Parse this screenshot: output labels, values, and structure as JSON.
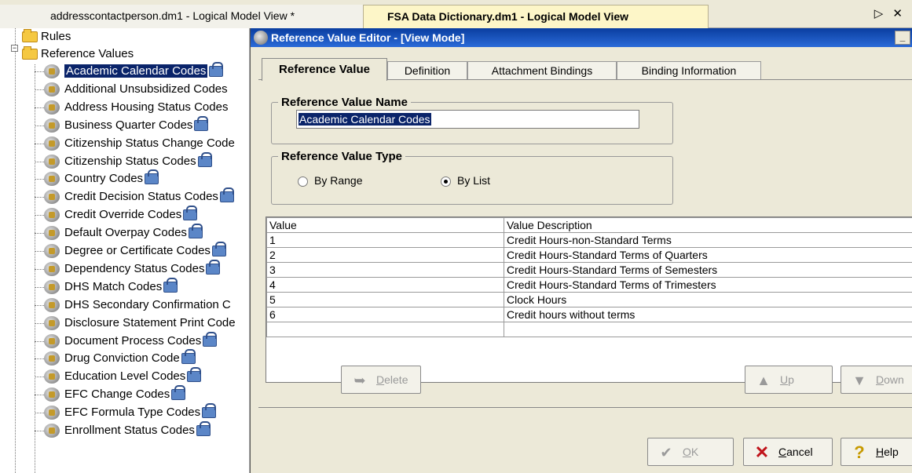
{
  "doc_tabs": [
    {
      "label": "addresscontactperson.dm1 - Logical Model View *"
    },
    {
      "label": "FSA Data Dictionary.dm1 - Logical Model View"
    }
  ],
  "tab_nav_glyph": "▷ ✕",
  "tree": {
    "rules": "Rules",
    "reference_values": "Reference Values",
    "items": [
      {
        "label": "Academic Calendar Codes",
        "locked": true,
        "selected": true
      },
      {
        "label": "Additional Unsubsidized Codes",
        "locked": false
      },
      {
        "label": "Address Housing Status Codes",
        "locked": false
      },
      {
        "label": "Business Quarter Codes",
        "locked": true
      },
      {
        "label": "Citizenship Status Change Code",
        "locked": false
      },
      {
        "label": "Citizenship Status Codes",
        "locked": true
      },
      {
        "label": "Country Codes",
        "locked": true
      },
      {
        "label": "Credit Decision Status Codes",
        "locked": true
      },
      {
        "label": "Credit Override Codes",
        "locked": true
      },
      {
        "label": "Default Overpay Codes",
        "locked": true
      },
      {
        "label": "Degree or Certificate Codes",
        "locked": true
      },
      {
        "label": "Dependency Status Codes",
        "locked": true
      },
      {
        "label": "DHS Match Codes",
        "locked": true
      },
      {
        "label": "DHS Secondary Confirmation C",
        "locked": false
      },
      {
        "label": "Disclosure Statement Print Code",
        "locked": false
      },
      {
        "label": "Document Process Codes",
        "locked": true
      },
      {
        "label": "Drug Conviction Code",
        "locked": true
      },
      {
        "label": "Education Level Codes",
        "locked": true
      },
      {
        "label": "EFC Change Codes",
        "locked": true
      },
      {
        "label": "EFC Formula Type Codes",
        "locked": true
      },
      {
        "label": "Enrollment Status Codes",
        "locked": true
      }
    ]
  },
  "dialog": {
    "title": "Reference Value Editor - [View Mode]",
    "minimize": "_",
    "tabs": [
      "Reference Value",
      "Definition",
      "Attachment Bindings",
      "Binding Information"
    ],
    "name_group": "Reference Value Name",
    "name_value": "Academic Calendar Codes",
    "type_group": "Reference Value Type",
    "by_range": "By Range",
    "by_list": "By List",
    "grid_headers": [
      "Value",
      "Value Description"
    ],
    "grid_rows": [
      [
        "1",
        "Credit Hours-non-Standard Terms"
      ],
      [
        "2",
        "Credit Hours-Standard Terms of Quarters"
      ],
      [
        "3",
        "Credit Hours-Standard Terms of Semesters"
      ],
      [
        "4",
        "Credit Hours-Standard Terms of Trimesters"
      ],
      [
        "5",
        "Clock Hours"
      ],
      [
        "6",
        "Credit hours without terms"
      ],
      [
        "",
        ""
      ]
    ],
    "delete_prefix": "",
    "delete_key": "D",
    "delete_rest": "elete",
    "up_key": "U",
    "up_rest": "p",
    "down_key": "D",
    "down_rest": "own",
    "ok_key": "O",
    "ok_rest": "K",
    "cancel_key": "C",
    "cancel_rest": "ancel",
    "help_key": "H",
    "help_rest": "elp"
  }
}
